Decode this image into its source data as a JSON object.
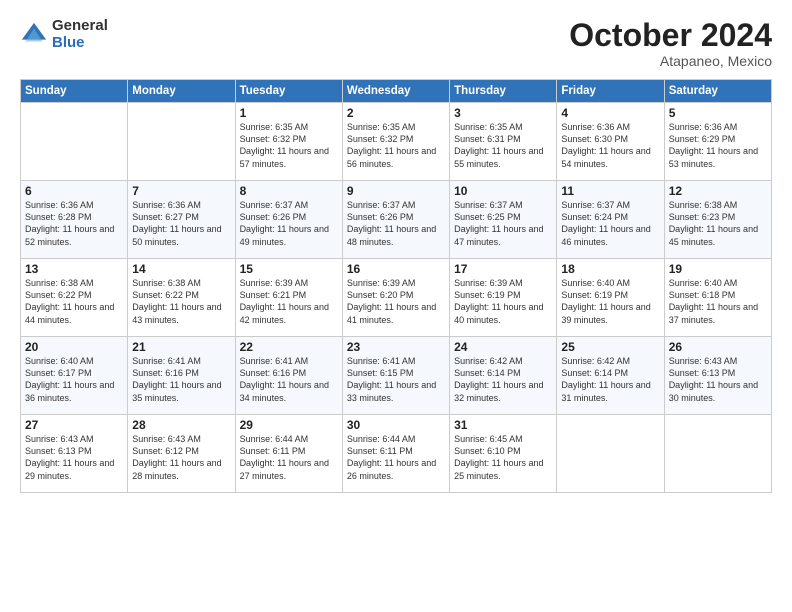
{
  "logo": {
    "general": "General",
    "blue": "Blue"
  },
  "header": {
    "month": "October 2024",
    "location": "Atapaneo, Mexico"
  },
  "weekdays": [
    "Sunday",
    "Monday",
    "Tuesday",
    "Wednesday",
    "Thursday",
    "Friday",
    "Saturday"
  ],
  "weeks": [
    [
      {
        "day": "",
        "sunrise": "",
        "sunset": "",
        "daylight": ""
      },
      {
        "day": "",
        "sunrise": "",
        "sunset": "",
        "daylight": ""
      },
      {
        "day": "1",
        "sunrise": "Sunrise: 6:35 AM",
        "sunset": "Sunset: 6:32 PM",
        "daylight": "Daylight: 11 hours and 57 minutes."
      },
      {
        "day": "2",
        "sunrise": "Sunrise: 6:35 AM",
        "sunset": "Sunset: 6:32 PM",
        "daylight": "Daylight: 11 hours and 56 minutes."
      },
      {
        "day": "3",
        "sunrise": "Sunrise: 6:35 AM",
        "sunset": "Sunset: 6:31 PM",
        "daylight": "Daylight: 11 hours and 55 minutes."
      },
      {
        "day": "4",
        "sunrise": "Sunrise: 6:36 AM",
        "sunset": "Sunset: 6:30 PM",
        "daylight": "Daylight: 11 hours and 54 minutes."
      },
      {
        "day": "5",
        "sunrise": "Sunrise: 6:36 AM",
        "sunset": "Sunset: 6:29 PM",
        "daylight": "Daylight: 11 hours and 53 minutes."
      }
    ],
    [
      {
        "day": "6",
        "sunrise": "Sunrise: 6:36 AM",
        "sunset": "Sunset: 6:28 PM",
        "daylight": "Daylight: 11 hours and 52 minutes."
      },
      {
        "day": "7",
        "sunrise": "Sunrise: 6:36 AM",
        "sunset": "Sunset: 6:27 PM",
        "daylight": "Daylight: 11 hours and 50 minutes."
      },
      {
        "day": "8",
        "sunrise": "Sunrise: 6:37 AM",
        "sunset": "Sunset: 6:26 PM",
        "daylight": "Daylight: 11 hours and 49 minutes."
      },
      {
        "day": "9",
        "sunrise": "Sunrise: 6:37 AM",
        "sunset": "Sunset: 6:26 PM",
        "daylight": "Daylight: 11 hours and 48 minutes."
      },
      {
        "day": "10",
        "sunrise": "Sunrise: 6:37 AM",
        "sunset": "Sunset: 6:25 PM",
        "daylight": "Daylight: 11 hours and 47 minutes."
      },
      {
        "day": "11",
        "sunrise": "Sunrise: 6:37 AM",
        "sunset": "Sunset: 6:24 PM",
        "daylight": "Daylight: 11 hours and 46 minutes."
      },
      {
        "day": "12",
        "sunrise": "Sunrise: 6:38 AM",
        "sunset": "Sunset: 6:23 PM",
        "daylight": "Daylight: 11 hours and 45 minutes."
      }
    ],
    [
      {
        "day": "13",
        "sunrise": "Sunrise: 6:38 AM",
        "sunset": "Sunset: 6:22 PM",
        "daylight": "Daylight: 11 hours and 44 minutes."
      },
      {
        "day": "14",
        "sunrise": "Sunrise: 6:38 AM",
        "sunset": "Sunset: 6:22 PM",
        "daylight": "Daylight: 11 hours and 43 minutes."
      },
      {
        "day": "15",
        "sunrise": "Sunrise: 6:39 AM",
        "sunset": "Sunset: 6:21 PM",
        "daylight": "Daylight: 11 hours and 42 minutes."
      },
      {
        "day": "16",
        "sunrise": "Sunrise: 6:39 AM",
        "sunset": "Sunset: 6:20 PM",
        "daylight": "Daylight: 11 hours and 41 minutes."
      },
      {
        "day": "17",
        "sunrise": "Sunrise: 6:39 AM",
        "sunset": "Sunset: 6:19 PM",
        "daylight": "Daylight: 11 hours and 40 minutes."
      },
      {
        "day": "18",
        "sunrise": "Sunrise: 6:40 AM",
        "sunset": "Sunset: 6:19 PM",
        "daylight": "Daylight: 11 hours and 39 minutes."
      },
      {
        "day": "19",
        "sunrise": "Sunrise: 6:40 AM",
        "sunset": "Sunset: 6:18 PM",
        "daylight": "Daylight: 11 hours and 37 minutes."
      }
    ],
    [
      {
        "day": "20",
        "sunrise": "Sunrise: 6:40 AM",
        "sunset": "Sunset: 6:17 PM",
        "daylight": "Daylight: 11 hours and 36 minutes."
      },
      {
        "day": "21",
        "sunrise": "Sunrise: 6:41 AM",
        "sunset": "Sunset: 6:16 PM",
        "daylight": "Daylight: 11 hours and 35 minutes."
      },
      {
        "day": "22",
        "sunrise": "Sunrise: 6:41 AM",
        "sunset": "Sunset: 6:16 PM",
        "daylight": "Daylight: 11 hours and 34 minutes."
      },
      {
        "day": "23",
        "sunrise": "Sunrise: 6:41 AM",
        "sunset": "Sunset: 6:15 PM",
        "daylight": "Daylight: 11 hours and 33 minutes."
      },
      {
        "day": "24",
        "sunrise": "Sunrise: 6:42 AM",
        "sunset": "Sunset: 6:14 PM",
        "daylight": "Daylight: 11 hours and 32 minutes."
      },
      {
        "day": "25",
        "sunrise": "Sunrise: 6:42 AM",
        "sunset": "Sunset: 6:14 PM",
        "daylight": "Daylight: 11 hours and 31 minutes."
      },
      {
        "day": "26",
        "sunrise": "Sunrise: 6:43 AM",
        "sunset": "Sunset: 6:13 PM",
        "daylight": "Daylight: 11 hours and 30 minutes."
      }
    ],
    [
      {
        "day": "27",
        "sunrise": "Sunrise: 6:43 AM",
        "sunset": "Sunset: 6:13 PM",
        "daylight": "Daylight: 11 hours and 29 minutes."
      },
      {
        "day": "28",
        "sunrise": "Sunrise: 6:43 AM",
        "sunset": "Sunset: 6:12 PM",
        "daylight": "Daylight: 11 hours and 28 minutes."
      },
      {
        "day": "29",
        "sunrise": "Sunrise: 6:44 AM",
        "sunset": "Sunset: 6:11 PM",
        "daylight": "Daylight: 11 hours and 27 minutes."
      },
      {
        "day": "30",
        "sunrise": "Sunrise: 6:44 AM",
        "sunset": "Sunset: 6:11 PM",
        "daylight": "Daylight: 11 hours and 26 minutes."
      },
      {
        "day": "31",
        "sunrise": "Sunrise: 6:45 AM",
        "sunset": "Sunset: 6:10 PM",
        "daylight": "Daylight: 11 hours and 25 minutes."
      },
      {
        "day": "",
        "sunrise": "",
        "sunset": "",
        "daylight": ""
      },
      {
        "day": "",
        "sunrise": "",
        "sunset": "",
        "daylight": ""
      }
    ]
  ]
}
